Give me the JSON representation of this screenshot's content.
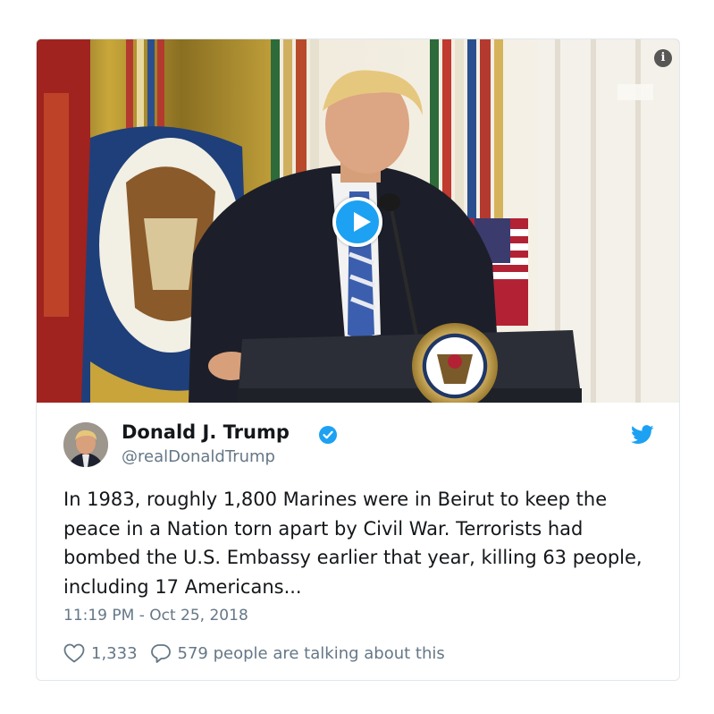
{
  "media": {
    "type": "video",
    "info_icon": "info-icon",
    "play_icon": "play-icon"
  },
  "author": {
    "name": "Donald J. Trump",
    "handle": "@realDonaldTrump",
    "verified": true,
    "verified_icon": "verified-badge-icon"
  },
  "tweet": {
    "text": "In 1983, roughly 1,800 Marines were in Beirut to keep the peace in a Nation torn apart by Civil War. Terrorists had bombed the U.S. Embassy earlier that year, killing 63 people, including 17 Americans...",
    "timestamp": "11:19 PM - Oct 25, 2018"
  },
  "actions": {
    "likes": "1,333",
    "talking": "579 people are talking about this"
  },
  "colors": {
    "brand": "#1da1f2",
    "text": "#14171a",
    "secondary": "#657786",
    "border": "#e1e8ed"
  }
}
